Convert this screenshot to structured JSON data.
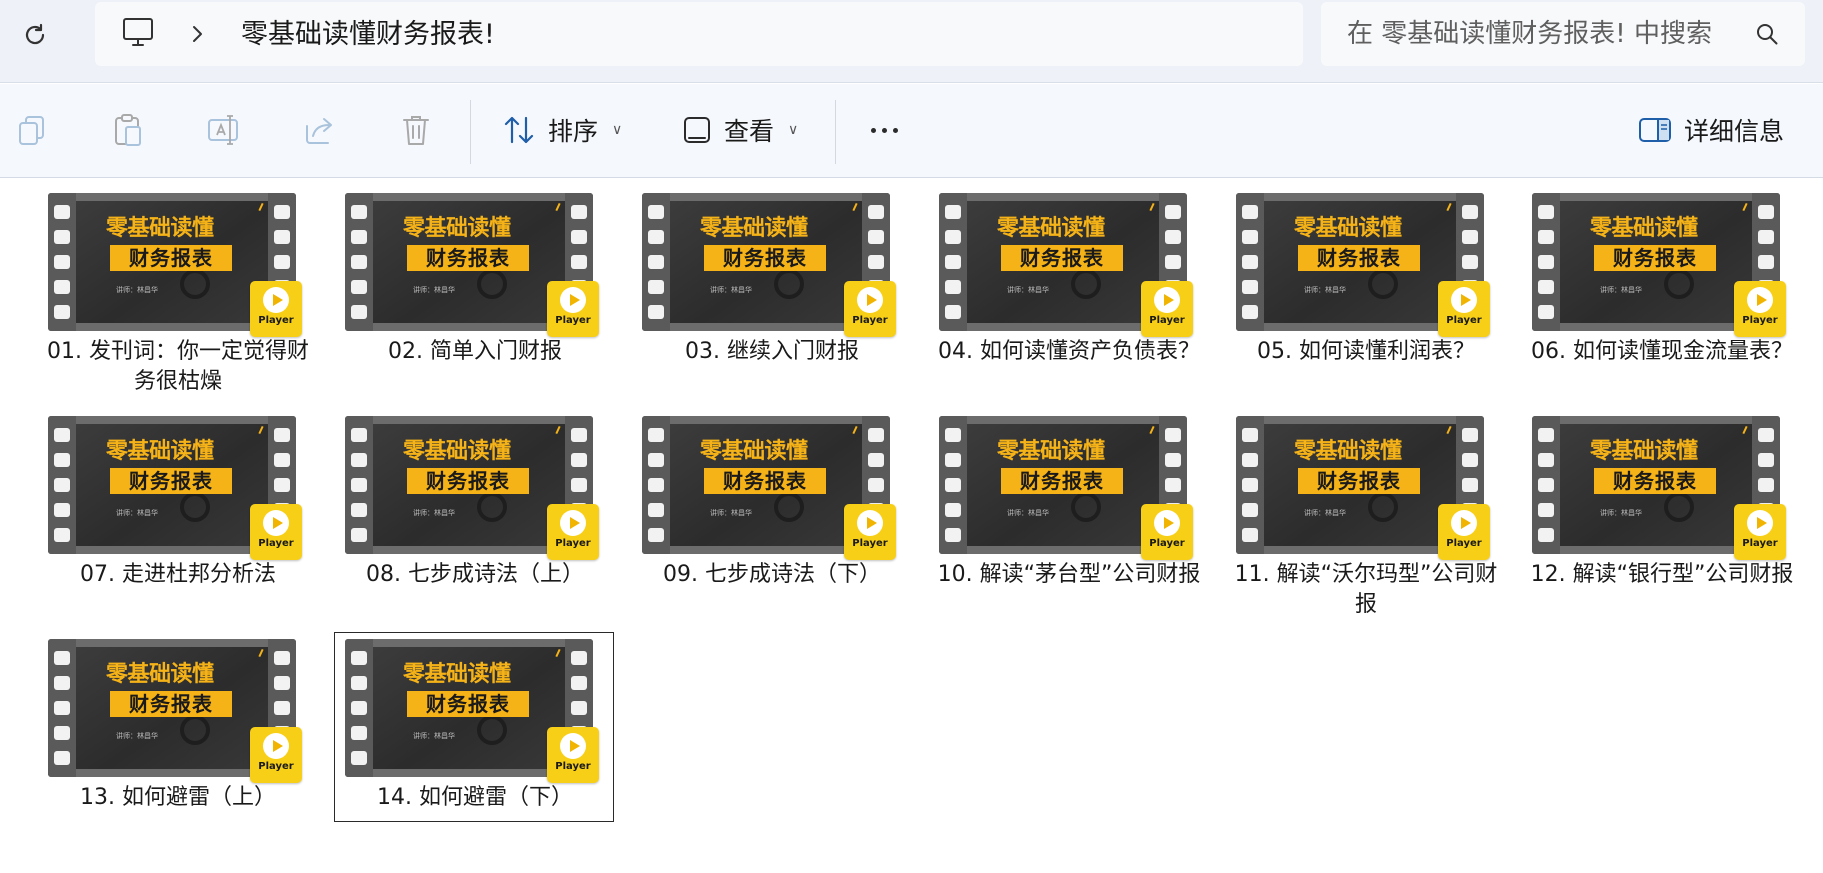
{
  "address_bar": {
    "path": "零基础读懂财务报表!",
    "search_placeholder": "在 零基础读懂财务报表! 中搜索"
  },
  "toolbar": {
    "sort_label": "排序",
    "view_label": "查看",
    "details_label": "详细信息"
  },
  "thumbnail_text": {
    "title_line1": "零基础读懂",
    "title_line2": "财务报表",
    "lecturer": "讲师：林昌华",
    "player_label": "Player"
  },
  "files": [
    {
      "name": "01. 发刊词：你一定觉得财务很枯燥",
      "selected": false
    },
    {
      "name": "02. 简单入门财报",
      "selected": false
    },
    {
      "name": "03. 继续入门财报",
      "selected": false
    },
    {
      "name": "04. 如何读懂资产负债表？",
      "selected": false
    },
    {
      "name": "05. 如何读懂利润表？",
      "selected": false
    },
    {
      "name": "06. 如何读懂现金流量表？",
      "selected": false
    },
    {
      "name": "07. 走进杜邦分析法",
      "selected": false
    },
    {
      "name": "08. 七步成诗法（上）",
      "selected": false
    },
    {
      "name": "09. 七步成诗法（下）",
      "selected": false
    },
    {
      "name": "10. 解读“茅台型”公司财报",
      "selected": false
    },
    {
      "name": "11. 解读“沃尔玛型”公司财报",
      "selected": false
    },
    {
      "name": "12. 解读“银行型”公司财报",
      "selected": false
    },
    {
      "name": "13. 如何避雷（上）",
      "selected": false
    },
    {
      "name": "14. 如何避雷（下）",
      "selected": true
    }
  ]
}
